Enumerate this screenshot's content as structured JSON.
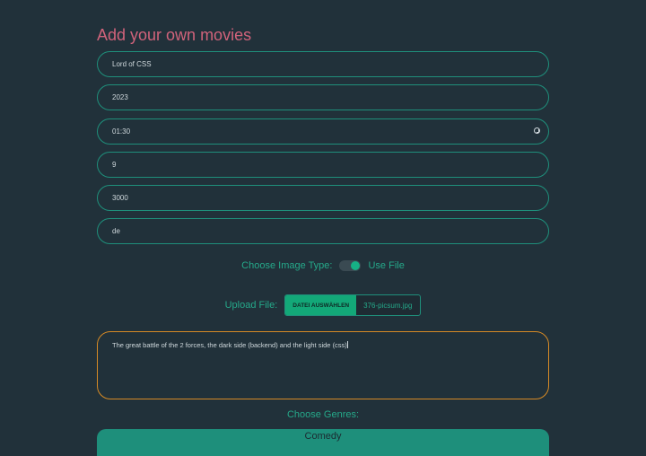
{
  "page": {
    "title": "Add your own movies"
  },
  "form": {
    "title_value": "Lord of CSS",
    "year_value": "2023",
    "duration_value": "01:30",
    "rating_value": "9",
    "budget_value": "3000",
    "language_value": "de",
    "image_type_label": "Choose Image Type:",
    "image_type_option": "Use File",
    "upload_label": "Upload File:",
    "upload_button": "DATEI AUSWÄHLEN",
    "upload_filename": "376-picsum.jpg",
    "description_value": "The great battle of the 2 forces, the dark side (backend) and the light side (css)",
    "genres_label": "Choose Genres:",
    "genre_first": "Comedy"
  },
  "colors": {
    "background": "#21313a",
    "title": "#d1637b",
    "accent": "#1f8f7b",
    "focus_border": "#d68a25"
  }
}
